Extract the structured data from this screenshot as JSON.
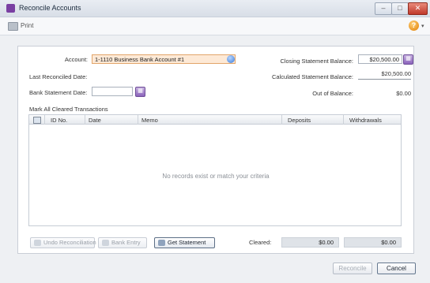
{
  "window": {
    "title": "Reconcile Accounts",
    "min": "–",
    "max": "□",
    "close": "✕"
  },
  "toolbar": {
    "print_label": "Print",
    "help_glyph": "?",
    "help_caret": "▾"
  },
  "form": {
    "account_label": "Account:",
    "account_value": "1-1110 Business Bank Account #1",
    "last_reconciled_label": "Last Reconciled Date:",
    "last_reconciled_value": "",
    "statement_date_label": "Bank Statement Date:",
    "statement_date_value": "",
    "closing_balance_label": "Closing Statement Balance:",
    "closing_balance_value": "$20,500.00",
    "calculated_balance_label": "Calculated Statement Balance:",
    "calculated_balance_value": "$20,500.00",
    "out_of_balance_label": "Out of Balance:",
    "out_of_balance_value": "$0.00",
    "mark_all_label": "Mark All Cleared Transactions"
  },
  "grid": {
    "columns": [
      "ID No.",
      "Date",
      "Memo",
      "Deposits",
      "Withdrawals"
    ],
    "empty_message": "No records exist or match your criteria"
  },
  "actions": {
    "undo_label": "Undo Reconciliation",
    "bank_entry_label": "Bank Entry",
    "get_statement_label": "Get Statement",
    "cleared_label": "Cleared:",
    "cleared_deposits": "$0.00",
    "cleared_withdrawals": "$0.00"
  },
  "footer": {
    "reconcile_label": "Reconcile",
    "cancel_label": "Cancel"
  },
  "icons": {
    "calendar_glyph": "▦",
    "dropdown_glyph": "▾"
  },
  "colors": {
    "accent": "#7a3fa2",
    "account_field_bg": "#fde9d6",
    "close_button": "#c0392b"
  }
}
